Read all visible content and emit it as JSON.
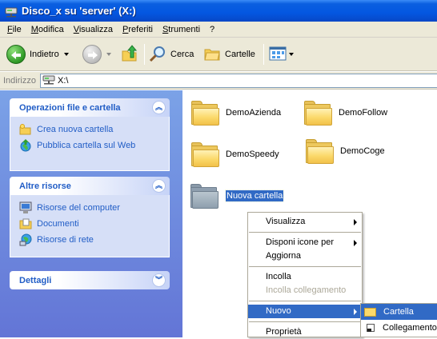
{
  "window": {
    "title": "Disco_x su 'server' (X:)"
  },
  "menubar": {
    "items": [
      "File",
      "Modifica",
      "Visualizza",
      "Preferiti",
      "Strumenti",
      "?"
    ]
  },
  "toolbar": {
    "back_label": "Indietro",
    "search_label": "Cerca",
    "folders_label": "Cartelle"
  },
  "address": {
    "label": "Indirizzo",
    "value": "X:\\"
  },
  "tasks": {
    "file_ops": {
      "title": "Operazioni file e cartella",
      "links": [
        "Crea nuova cartella",
        "Pubblica cartella sul Web"
      ]
    },
    "other": {
      "title": "Altre risorse",
      "links": [
        "Risorse del computer",
        "Documenti",
        "Risorse di rete"
      ]
    },
    "details": {
      "title": "Dettagli"
    }
  },
  "folders": [
    "DemoAzienda",
    "DemoFollow",
    "DemoSpeedy",
    "DemoCoge",
    "Nuova cartella"
  ],
  "context_menu": {
    "visualizza": "Visualizza",
    "disponi": "Disponi icone per",
    "aggiorna": "Aggiorna",
    "incolla": "Incolla",
    "incolla_collegamento": "Incolla collegamento",
    "nuovo": "Nuovo",
    "proprieta": "Proprietà"
  },
  "submenu": {
    "cartella": "Cartella",
    "collegamento": "Collegamento"
  },
  "colors": {
    "titlebar": "#0457e1",
    "taskpane": "#7ba2e7",
    "link": "#215dc6",
    "selection": "#316ac5"
  }
}
